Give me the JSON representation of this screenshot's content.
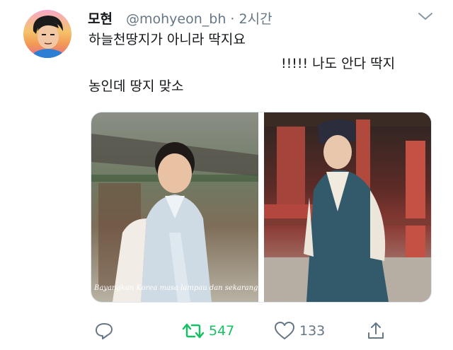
{
  "tweet": {
    "display_name": "모현",
    "handle_line": "@mohyeon_bh · 2시간",
    "text_lines": [
      "하늘천땅지가 아니라 딱지요",
      "!!!!! 나도 안다 딱지",
      "농인데 땅지 맞소"
    ],
    "media_caption": "Bayangkan Korea masa lampau dan sekarang!",
    "retweet_count": "547",
    "like_count": "133"
  },
  "icons": {
    "menu": "chevron-down-icon",
    "reply": "reply-icon",
    "retweet": "retweet-icon",
    "like": "heart-icon",
    "share": "share-icon"
  },
  "colors": {
    "retweet_active": "#17bf63",
    "muted": "#657786",
    "text": "#14171a"
  }
}
